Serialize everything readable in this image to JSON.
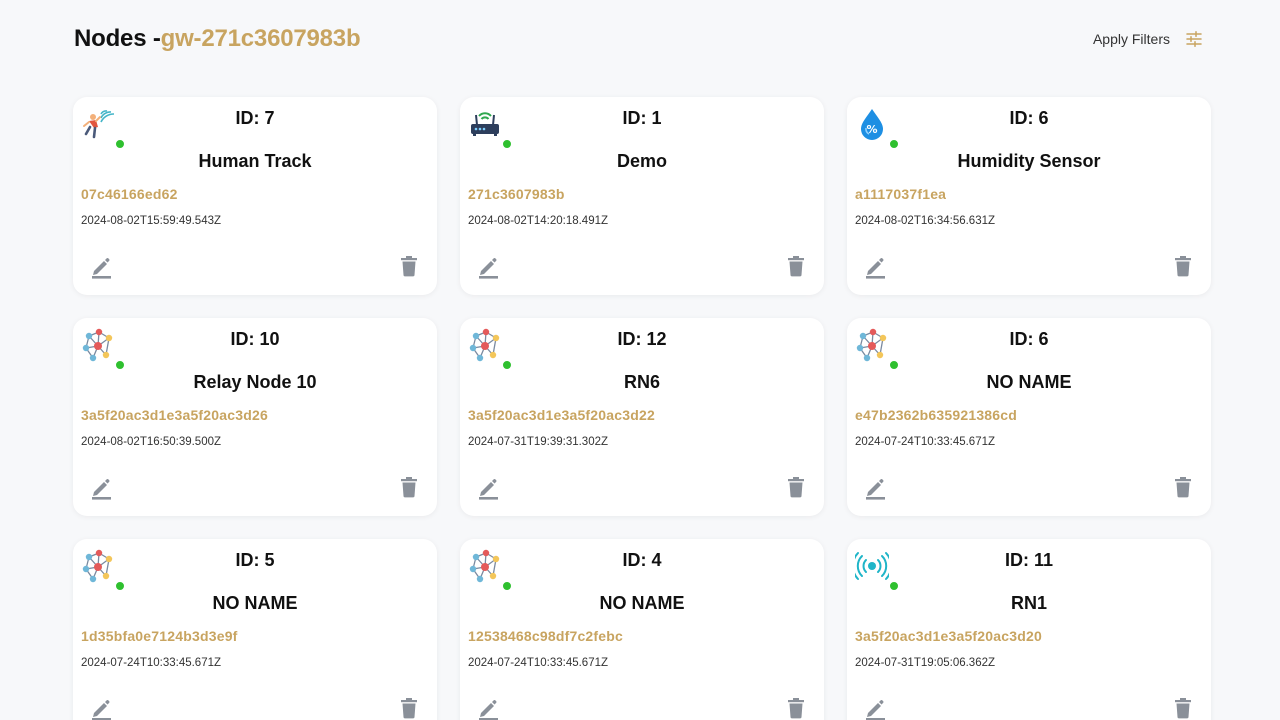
{
  "header": {
    "title_prefix": "Nodes -",
    "gateway_id": "gw-271c3607983b",
    "apply_filters_label": "Apply Filters"
  },
  "colors": {
    "accent": "#c8a460",
    "status_online": "#2fc02f",
    "action_icon": "#8a9099"
  },
  "cards": [
    {
      "id_label": "ID: 7",
      "name": "Human Track",
      "mac": "07c46166ed62",
      "timestamp": "2024-08-02T15:59:49.543Z",
      "icon": "human-track-icon"
    },
    {
      "id_label": "ID: 1",
      "name": "Demo",
      "mac": "271c3607983b",
      "timestamp": "2024-08-02T14:20:18.491Z",
      "icon": "router-icon"
    },
    {
      "id_label": "ID: 6",
      "name": "Humidity Sensor",
      "mac": "a1117037f1ea",
      "timestamp": "2024-08-02T16:34:56.631Z",
      "icon": "humidity-drop-icon"
    },
    {
      "id_label": "ID: 10",
      "name": "Relay Node 10",
      "mac": "3a5f20ac3d1e3a5f20ac3d26",
      "timestamp": "2024-08-02T16:50:39.500Z",
      "icon": "network-nodes-icon"
    },
    {
      "id_label": "ID: 12",
      "name": "RN6",
      "mac": "3a5f20ac3d1e3a5f20ac3d22",
      "timestamp": "2024-07-31T19:39:31.302Z",
      "icon": "network-nodes-icon"
    },
    {
      "id_label": "ID: 6",
      "name": "NO NAME",
      "mac": "e47b2362b635921386cd",
      "timestamp": "2024-07-24T10:33:45.671Z",
      "icon": "network-nodes-icon"
    },
    {
      "id_label": "ID: 5",
      "name": "NO NAME",
      "mac": "1d35bfa0e7124b3d3e9f",
      "timestamp": "2024-07-24T10:33:45.671Z",
      "icon": "network-nodes-icon"
    },
    {
      "id_label": "ID: 4",
      "name": "NO NAME",
      "mac": "12538468c98df7c2febc",
      "timestamp": "2024-07-24T10:33:45.671Z",
      "icon": "network-nodes-icon"
    },
    {
      "id_label": "ID: 11",
      "name": "RN1",
      "mac": "3a5f20ac3d1e3a5f20ac3d20",
      "timestamp": "2024-07-31T19:05:06.362Z",
      "icon": "broadcast-signal-icon"
    }
  ]
}
